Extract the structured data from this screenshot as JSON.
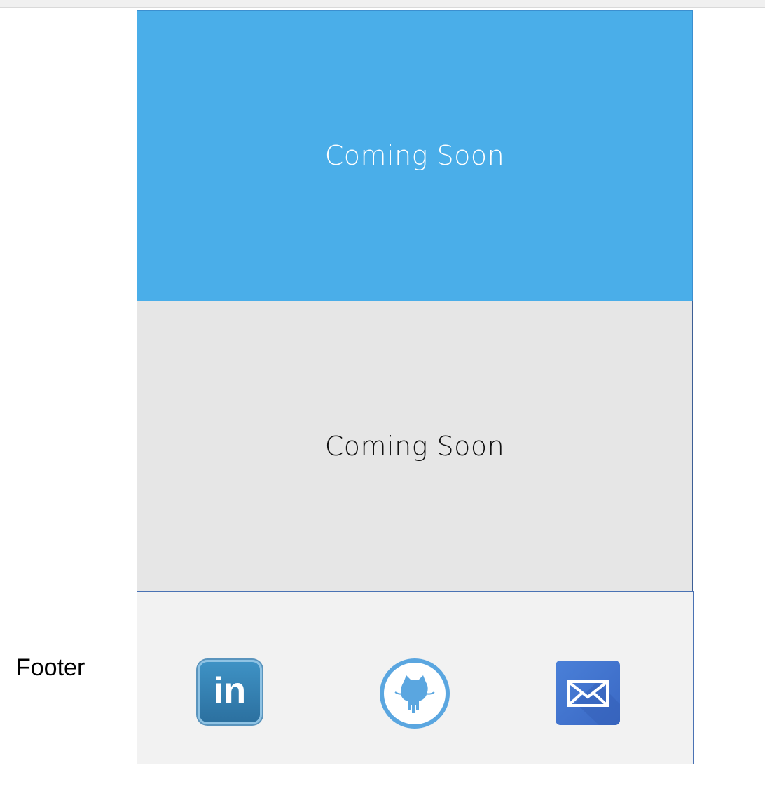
{
  "sections": {
    "hero": {
      "text": "Coming Soon"
    },
    "second": {
      "text": "Coming Soon"
    }
  },
  "side_label": "Footer",
  "footer": {
    "icons": [
      {
        "name": "linkedin-icon",
        "glyph": "in"
      },
      {
        "name": "github-icon"
      },
      {
        "name": "mail-icon"
      }
    ]
  },
  "colors": {
    "hero_bg": "#4aaee9",
    "second_bg": "#e6e6e6",
    "footer_bg": "#f2f2f2",
    "border": "#4a72b4"
  }
}
